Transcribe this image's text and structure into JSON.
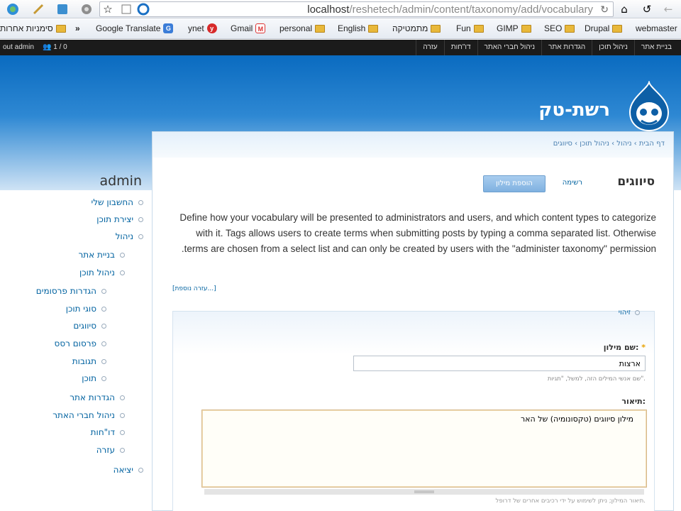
{
  "browser": {
    "url_host": "localhost",
    "url_path": "/reshetech/admin/content/taxonomy/add/vocabulary",
    "toolbar_icons": [
      "home-icon",
      "refresh-icon",
      "back-icon",
      "star-icon",
      "page-icon",
      "ie-icon",
      "wrench-icon"
    ]
  },
  "bookmarks": [
    {
      "label": "סימניות אחרות",
      "icon": "folder-icon"
    },
    {
      "label": "Google Translate",
      "icon": "translate-icon"
    },
    {
      "label": "ynet",
      "icon": "ynet-icon"
    },
    {
      "label": "Gmail",
      "icon": "gmail-icon"
    },
    {
      "label": "personal",
      "icon": "folder-icon"
    },
    {
      "label": "English",
      "icon": "folder-icon"
    },
    {
      "label": "מתמטיקה",
      "icon": "folder-icon"
    },
    {
      "label": "Fun",
      "icon": "folder-icon"
    },
    {
      "label": "GIMP",
      "icon": "folder-icon"
    },
    {
      "label": "SEO",
      "icon": "folder-icon"
    },
    {
      "label": "Drupal",
      "icon": "folder-icon"
    },
    {
      "label": "webmaster",
      "icon": "folder-icon"
    }
  ],
  "admin_toolbar": {
    "logout": "out admin",
    "users": "1 / 0",
    "menu": [
      "בניית אתר",
      "ניהול תוכן",
      "הגדרות אתר",
      "ניהול חברי האתר",
      "דו\"חות",
      "עזרה"
    ]
  },
  "site": {
    "name": "רשת-טק"
  },
  "sidebar": {
    "title": "admin",
    "items": [
      {
        "label": "החשבון שלי",
        "level": 0
      },
      {
        "label": "יצירת תוכן",
        "level": 0
      },
      {
        "label": "ניהול",
        "level": 0
      },
      {
        "label": "בניית אתר",
        "level": 1
      },
      {
        "label": "ניהול תוכן",
        "level": 1
      },
      {
        "label": "הגדרות פרסומים",
        "level": 2
      },
      {
        "label": "סוגי תוכן",
        "level": 2
      },
      {
        "label": "סיווגים",
        "level": 2
      },
      {
        "label": "פרסום רסס",
        "level": 2
      },
      {
        "label": "תגובות",
        "level": 2
      },
      {
        "label": "תוכן",
        "level": 2
      },
      {
        "label": "הגדרות אתר",
        "level": 1
      },
      {
        "label": "ניהול חברי האתר",
        "level": 1
      },
      {
        "label": "דו\"חות",
        "level": 1
      },
      {
        "label": "עזרה",
        "level": 1
      },
      {
        "label": "יציאה",
        "level": 0
      }
    ]
  },
  "breadcrumb": "דף הבית › ניהול › ניהול תוכן › סיווגים",
  "page": {
    "title": "סיווגים",
    "tab_list": "רשימה",
    "tab_add": "הוספת מילון",
    "help_text": "Define how your vocabulary will be presented to administrators and users, and which content types to categorize with it. Tags allows users to create terms when submitting posts by typing a comma separated list. Otherwise terms are chosen from a select list and can only be created by users with the \"administer taxonomy\" permission.",
    "more_help": "[עזרה נוספת...]"
  },
  "form": {
    "fieldset_legend": "זיהוי",
    "name_label": "שם מילון:",
    "name_required": "*",
    "name_value": "ארצות",
    "name_description": "שם אנשי המילים הזה, למשל, \"תגיות\".",
    "desc_label": "תיאור:",
    "desc_value": "מילון סיווגים (טקסונומיה) של האר",
    "desc_help": "תיאור המילון; ניתן לשימוש על ידי רכיבים אחרים של דרופל."
  }
}
